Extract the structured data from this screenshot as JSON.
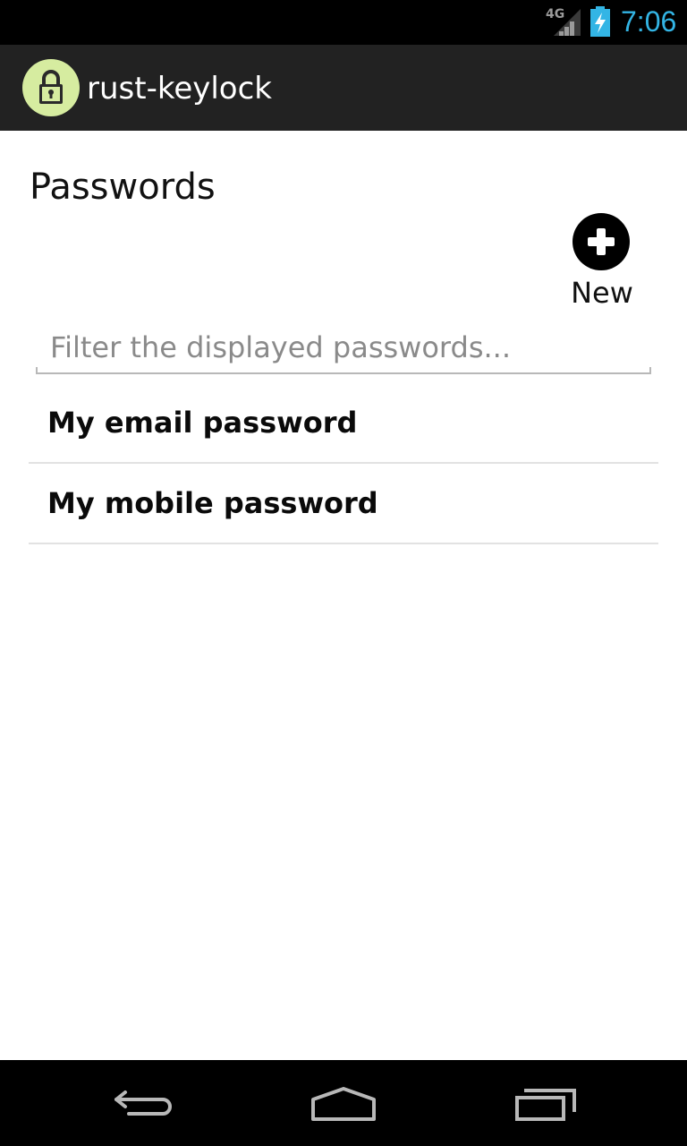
{
  "status_bar": {
    "network": "4G",
    "time": "7:06",
    "signal_icon": "signal-icon",
    "battery_icon": "battery-charging-icon",
    "time_color": "#33b5e5"
  },
  "action_bar": {
    "title": "rust-keylock",
    "icon": "padlock-icon",
    "icon_bg": "#d6eca0"
  },
  "main": {
    "section_title": "Passwords",
    "new_button_label": "New",
    "filter": {
      "placeholder": "Filter the displayed passwords...",
      "value": ""
    },
    "passwords": [
      {
        "name": "My email password"
      },
      {
        "name": "My mobile password"
      }
    ]
  },
  "nav_bar": {
    "back": "back-icon",
    "home": "home-icon",
    "recents": "recents-icon"
  }
}
